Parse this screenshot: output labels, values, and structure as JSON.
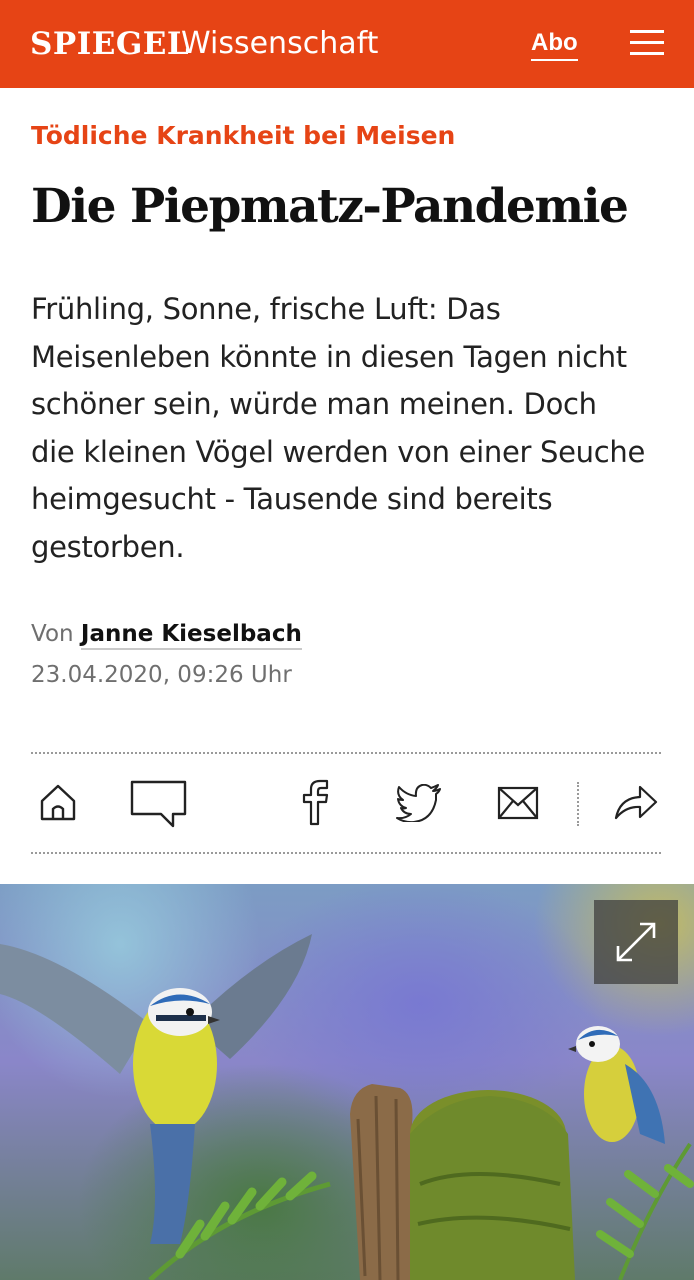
{
  "header": {
    "logo": "SPIEGEL",
    "section": "Wissenschaft",
    "abo_label": "Abo",
    "menu_icon": "hamburger-menu-icon",
    "background_color": "#e64415"
  },
  "article": {
    "kicker": "Tödliche Krankheit bei Meisen",
    "headline": "Die Piepmatz-Pandemie",
    "teaser_lines": [
      "Frühling, Sonne, frische Luft: Das",
      "Meisenleben könnte in diesen Tagen nicht",
      "schöner sein, würde man meinen. Doch",
      "die kleinen Vögel werden von einer Seuche",
      "heimgesucht - Tausende sind bereits",
      "gestorben."
    ],
    "byline_prefix": "Von",
    "author": "Janne Kieselbach",
    "date": "23.04.2020, 09:26 Uhr",
    "accent_color": "#e64415"
  },
  "toolbar": {
    "icons": [
      "home-icon",
      "comment-icon",
      "facebook-icon",
      "twitter-icon",
      "mail-icon",
      "share-icon"
    ]
  },
  "hero_image": {
    "subject": "blue tits on mossy stump",
    "expand_icon": "expand-icon"
  }
}
